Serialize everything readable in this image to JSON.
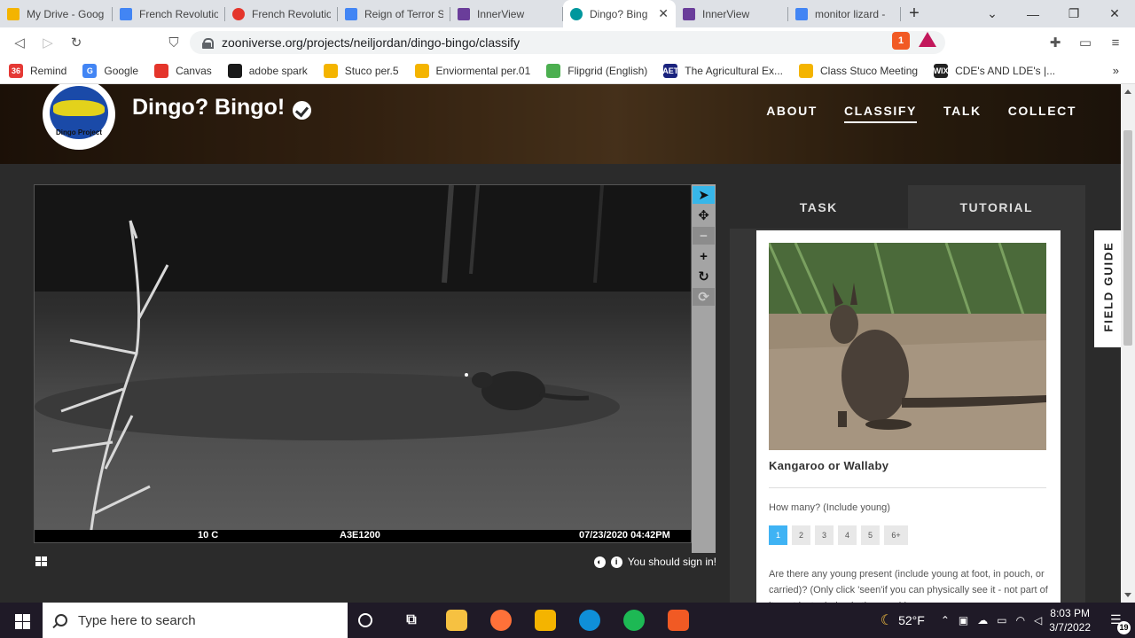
{
  "browser": {
    "tabs": [
      {
        "title": "My Drive - Goog",
        "icon": "drive-icon",
        "color": "#f4b400",
        "active": false
      },
      {
        "title": "French Revolutio",
        "icon": "docs-icon",
        "color": "#4285f4",
        "active": false
      },
      {
        "title": "French Revolutio",
        "icon": "canvas-icon",
        "color": "#e4352b",
        "active": false
      },
      {
        "title": "Reign of Terror S",
        "icon": "docs-icon",
        "color": "#4285f4",
        "active": false
      },
      {
        "title": "InnerView",
        "icon": "innerview-icon",
        "color": "#6a3d9a",
        "active": false
      },
      {
        "title": "Dingo? Bing",
        "icon": "zooniverse-icon",
        "color": "#00979d",
        "active": true
      },
      {
        "title": "InnerView",
        "icon": "innerview-icon",
        "color": "#6a3d9a",
        "active": false
      },
      {
        "title": "monitor lizard -",
        "icon": "google-icon",
        "color": "#4285f4",
        "active": false
      }
    ],
    "new_tab_label": "+",
    "url": "zooniverse.org/projects/neiljordan/dingo-bingo/classify",
    "brave_badge": "1",
    "bookmarks": [
      {
        "label": "Remind",
        "icon": "remind-icon",
        "badge": "36",
        "color": "#e53935"
      },
      {
        "label": "Google",
        "icon": "google-icon",
        "badge": "G",
        "color": "#4285f4"
      },
      {
        "label": "Canvas",
        "icon": "canvas-icon",
        "badge": "",
        "color": "#e4352b"
      },
      {
        "label": "adobe spark",
        "icon": "adobe-spark-icon",
        "badge": "",
        "color": "#1a1a1a"
      },
      {
        "label": "Stuco per.5",
        "icon": "classroom-icon",
        "badge": "",
        "color": "#f4b400"
      },
      {
        "label": "Enviormental per.01",
        "icon": "classroom-icon",
        "badge": "",
        "color": "#f4b400"
      },
      {
        "label": "Flipgrid (English)",
        "icon": "flipgrid-icon",
        "badge": "",
        "color": "#4caf50"
      },
      {
        "label": "The Agricultural Ex...",
        "icon": "aet-icon",
        "badge": "AET",
        "color": "#1a237e"
      },
      {
        "label": "Class Stuco Meeting",
        "icon": "classroom-icon",
        "badge": "",
        "color": "#f4b400"
      },
      {
        "label": "CDE's AND LDE's |...",
        "icon": "wix-icon",
        "badge": "WIX",
        "color": "#222222"
      }
    ],
    "more_bookmarks": "»"
  },
  "header": {
    "logo_text": "Dingo Project",
    "title": "Dingo? Bingo!",
    "nav": [
      {
        "label": "ABOUT",
        "active": false
      },
      {
        "label": "CLASSIFY",
        "active": true
      },
      {
        "label": "TALK",
        "active": false
      },
      {
        "label": "COLLECT",
        "active": false
      }
    ]
  },
  "subject": {
    "cam_temp": "10 C",
    "cam_id": "A3E1200",
    "cam_datetime": "07/23/2020  04:42PM",
    "signin_text": "You should sign in!"
  },
  "task_panel": {
    "tabs": [
      {
        "label": "TASK",
        "active": true
      },
      {
        "label": "TUTORIAL",
        "active": false
      }
    ],
    "animal_name": "Kangaroo or Wallaby",
    "how_many_question": "How many? (Include young)",
    "counts": [
      "1",
      "2",
      "3",
      "4",
      "5",
      "6+"
    ],
    "selected_count": "1",
    "young_question": "Are there any young present (include young at foot, in pouch, or carried)? (Only click 'seen'if you can physically see it - not part of it - not just a bulge in the pouch)",
    "field_guide_label": "FIELD GUIDE"
  },
  "taskbar": {
    "search_placeholder": "Type here to search",
    "weather": "52°F",
    "time": "8:03 PM",
    "date": "3/7/2022",
    "notifications": "19"
  }
}
